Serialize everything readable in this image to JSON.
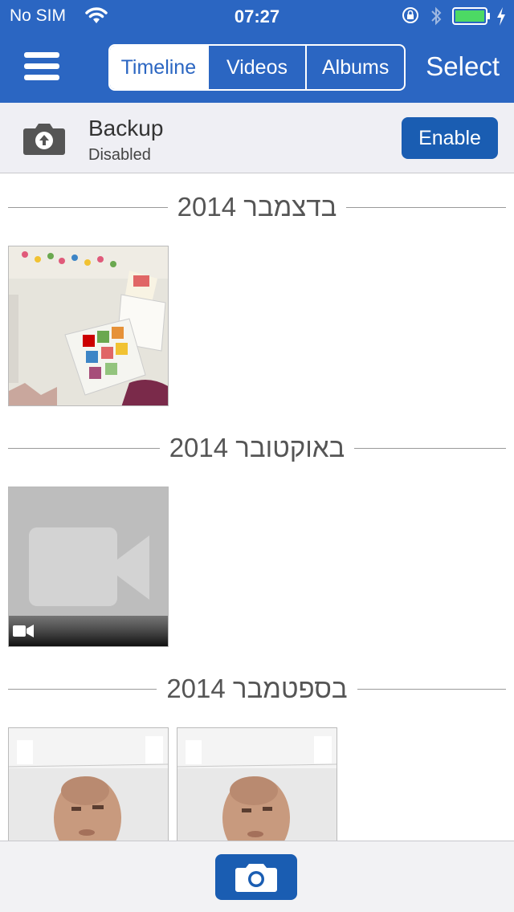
{
  "status_bar": {
    "carrier": "No SIM",
    "time": "07:27"
  },
  "header": {
    "tabs": [
      {
        "label": "Timeline",
        "active": true
      },
      {
        "label": "Videos",
        "active": false
      },
      {
        "label": "Albums",
        "active": false
      }
    ],
    "select_label": "Select"
  },
  "backup": {
    "title": "Backup",
    "status": "Disabled",
    "enable_label": "Enable"
  },
  "sections": [
    {
      "label": "בדצמבר 2014"
    },
    {
      "label": "באוקטובר 2014"
    },
    {
      "label": "בספטמבר 2014"
    }
  ],
  "colors": {
    "accent": "#2b66c2",
    "button": "#1a5db2",
    "battery": "#4cd964"
  }
}
